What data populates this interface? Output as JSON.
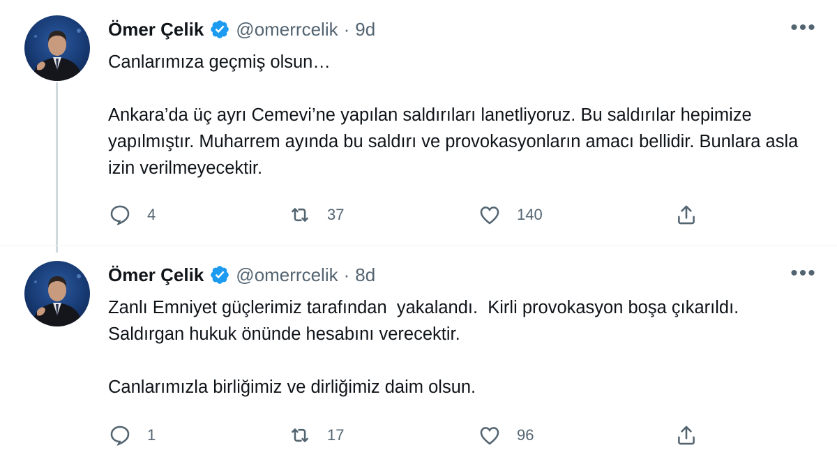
{
  "tweets": [
    {
      "author_name": "Ömer Çelik",
      "handle": "@omerrcelik",
      "separator": "·",
      "time": "9d",
      "more_label": "•••",
      "text": "Canlarımıza geçmiş olsun…\n\nAnkara’da üç ayrı Cemevi’ne yapılan saldırıları lanetliyoruz. Bu saldırılar hepimize yapılmıştır. Muharrem ayında bu saldırı ve provokasyonların amacı bellidir. Bunlara asla izin verilmeyecektir.",
      "replies": "4",
      "retweets": "37",
      "likes": "140"
    },
    {
      "author_name": "Ömer Çelik",
      "handle": "@omerrcelik",
      "separator": "·",
      "time": "8d",
      "more_label": "•••",
      "text": "Zanlı Emniyet güçlerimiz tarafından  yakalandı.  Kirli provokasyon boşa çıkarıldı. Saldırgan hukuk önünde hesabını verecektir.\n\nCanlarımızla birliğimiz ve dirliğimiz daim olsun.",
      "replies": "1",
      "retweets": "17",
      "likes": "96"
    }
  ],
  "icons": {
    "reply": "reply-icon",
    "retweet": "retweet-icon",
    "like": "like-icon",
    "share": "share-icon",
    "verified": "verified-badge-icon",
    "more": "more-options-icon"
  },
  "colors": {
    "text_primary": "#0f1419",
    "text_secondary": "#536471",
    "verified_blue": "#1d9bf0",
    "thread_line": "#cfd9de"
  }
}
